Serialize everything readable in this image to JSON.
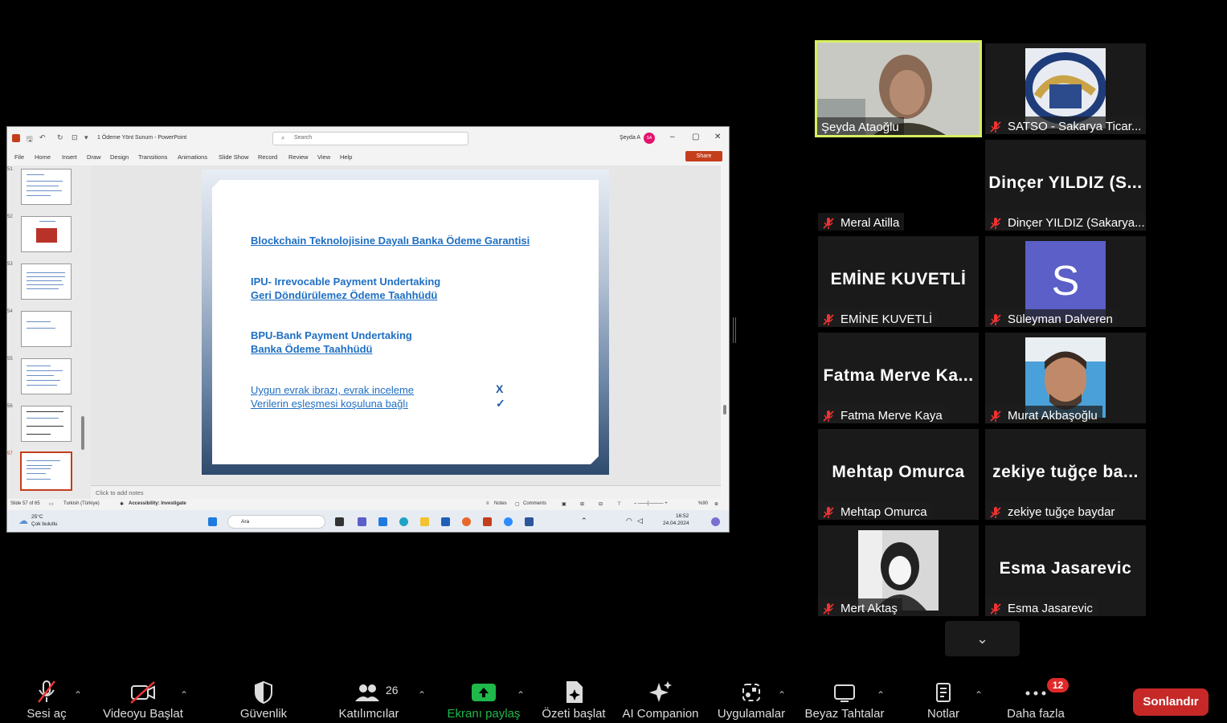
{
  "ppt": {
    "doc_title": "1 Ödeme Yönt Sunum  -  PowerPoint",
    "search_placeholder": "Search",
    "user": "Şeyda A",
    "avatar_initials": "SA",
    "ribbon_tabs": [
      "File",
      "Home",
      "Insert",
      "Draw",
      "Design",
      "Transitions",
      "Animations",
      "Slide Show",
      "Record",
      "Review",
      "View",
      "Help"
    ],
    "share_label": "Share",
    "thumb_numbers": [
      "51",
      "52",
      "53",
      "54",
      "55",
      "56",
      "57"
    ],
    "slide": {
      "title": "Blockchain Teknolojisine Dayalı Banka Ödeme Garantisi",
      "ipu_1": "IPU- Irrevocable Payment Undertaking",
      "ipu_2": "Geri Döndürülemez Ödeme Taahhüdü",
      "bpu_1": "BPU-Bank Payment Undertaking",
      "bpu_2": "Banka Ödeme Taahhüdü",
      "line_1": "Uygun evrak ibrazı, evrak inceleme",
      "line_2": "Verilerin eşleşmesi koşuluna bağlı",
      "mark_1": "X",
      "mark_2": "✓"
    },
    "notes_placeholder": "Click to add notes",
    "status": {
      "slide_count": "Slide 57 of 65",
      "language": "Turkish (Türkiye)",
      "accessibility": "Accessibility: Investigate",
      "notes": "Notes",
      "comments": "Comments",
      "zoom": "%90"
    },
    "taskbar": {
      "weather_temp": "25°C",
      "weather_desc": "Çok bulutlu",
      "search": "Ara",
      "time": "16:52",
      "date": "24.04.2024"
    }
  },
  "participants": [
    {
      "name": "Şeyda Ataoğlu",
      "big": "",
      "muted": false,
      "active": true
    },
    {
      "name": "SATSO - Sakarya Ticar...",
      "big": "",
      "muted": true
    },
    {
      "name": "Meral Atilla",
      "big": "",
      "muted": true
    },
    {
      "name": "Dinçer YILDIZ (Sakarya...",
      "big": "Dinçer YILDIZ (S...",
      "muted": true
    },
    {
      "name": "EMİNE KUVETLİ",
      "big": "EMİNE KUVETLİ",
      "muted": true
    },
    {
      "name": "Süleyman Dalveren",
      "big": "",
      "avatar_letter": "S",
      "muted": true
    },
    {
      "name": "Fatma Merve Kaya",
      "big": "Fatma Merve Ka...",
      "muted": true
    },
    {
      "name": "Murat Akbaşoğlu",
      "big": "",
      "muted": true
    },
    {
      "name": "Mehtap Omurca",
      "big": "Mehtap Omurca",
      "muted": true
    },
    {
      "name": "zekiye tuğçe baydar",
      "big": "zekiye tuğçe ba...",
      "muted": true
    },
    {
      "name": "Mert Aktaş",
      "big": "",
      "muted": true
    },
    {
      "name": "Esma Jasarevic",
      "big": "Esma Jasarevic",
      "muted": true
    }
  ],
  "toolbar": {
    "mute": "Sesi aç",
    "video": "Videoyu Başlat",
    "security": "Güvenlik",
    "participants": "Katılımcılar",
    "participant_count": "26",
    "share": "Ekranı paylaş",
    "summary": "Özeti başlat",
    "ai": "AI Companion",
    "apps": "Uygulamalar",
    "whiteboard": "Beyaz Tahtalar",
    "notes": "Notlar",
    "more": "Daha fazla",
    "more_badge": "12",
    "end": "Sonlandır"
  },
  "colors": {
    "active_speaker_border": "#d6f060",
    "share_green": "#1fb84a",
    "end_red": "#c62828",
    "slide_text": "#1f6fc3",
    "avatar_purple": "#5b5fc7"
  }
}
